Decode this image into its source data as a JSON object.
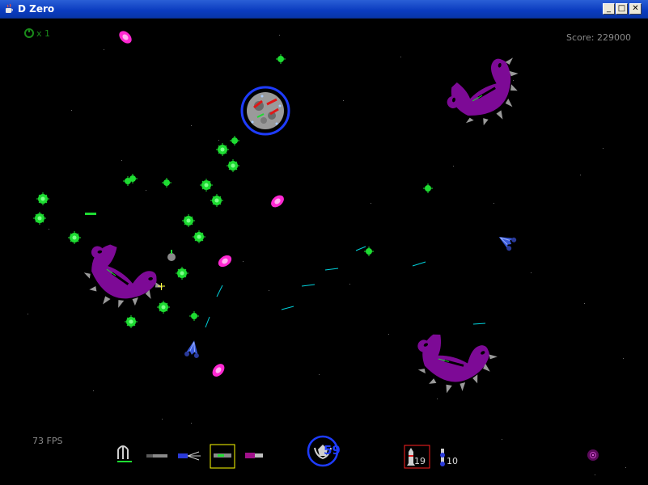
{
  "window": {
    "title": "D Zero",
    "minimize_label": "_",
    "maximize_label": "□",
    "close_label": "✕"
  },
  "hud": {
    "lives": "x 1",
    "score": "Score: 229000",
    "fps": "73 FPS",
    "shield_value": "59",
    "ammo_primary": "19",
    "ammo_secondary": "10",
    "selected_weapon_index": 3
  },
  "colors": {
    "background": "#000000",
    "enemy_purple": "#7d0a96",
    "plasma_magenta": "#ff28d2",
    "green_orb": "#1edc32",
    "laser_cyan": "#00d2dc",
    "shield_blue": "#1e3cff",
    "selection_yellow": "#ffff00",
    "selection_red": "#ff2020"
  },
  "icons": {
    "app": "java-cup-icon",
    "lives": "ship-life-icon",
    "shield": "shield-emblem-icon",
    "weapons": [
      "triple-cannon-icon",
      "rail-gun-icon",
      "spread-laser-icon",
      "green-blaster-icon",
      "plasma-cannon-icon"
    ],
    "missile": "missile-icon",
    "bomb": "bomb-icon",
    "radar": "radar-icon"
  }
}
